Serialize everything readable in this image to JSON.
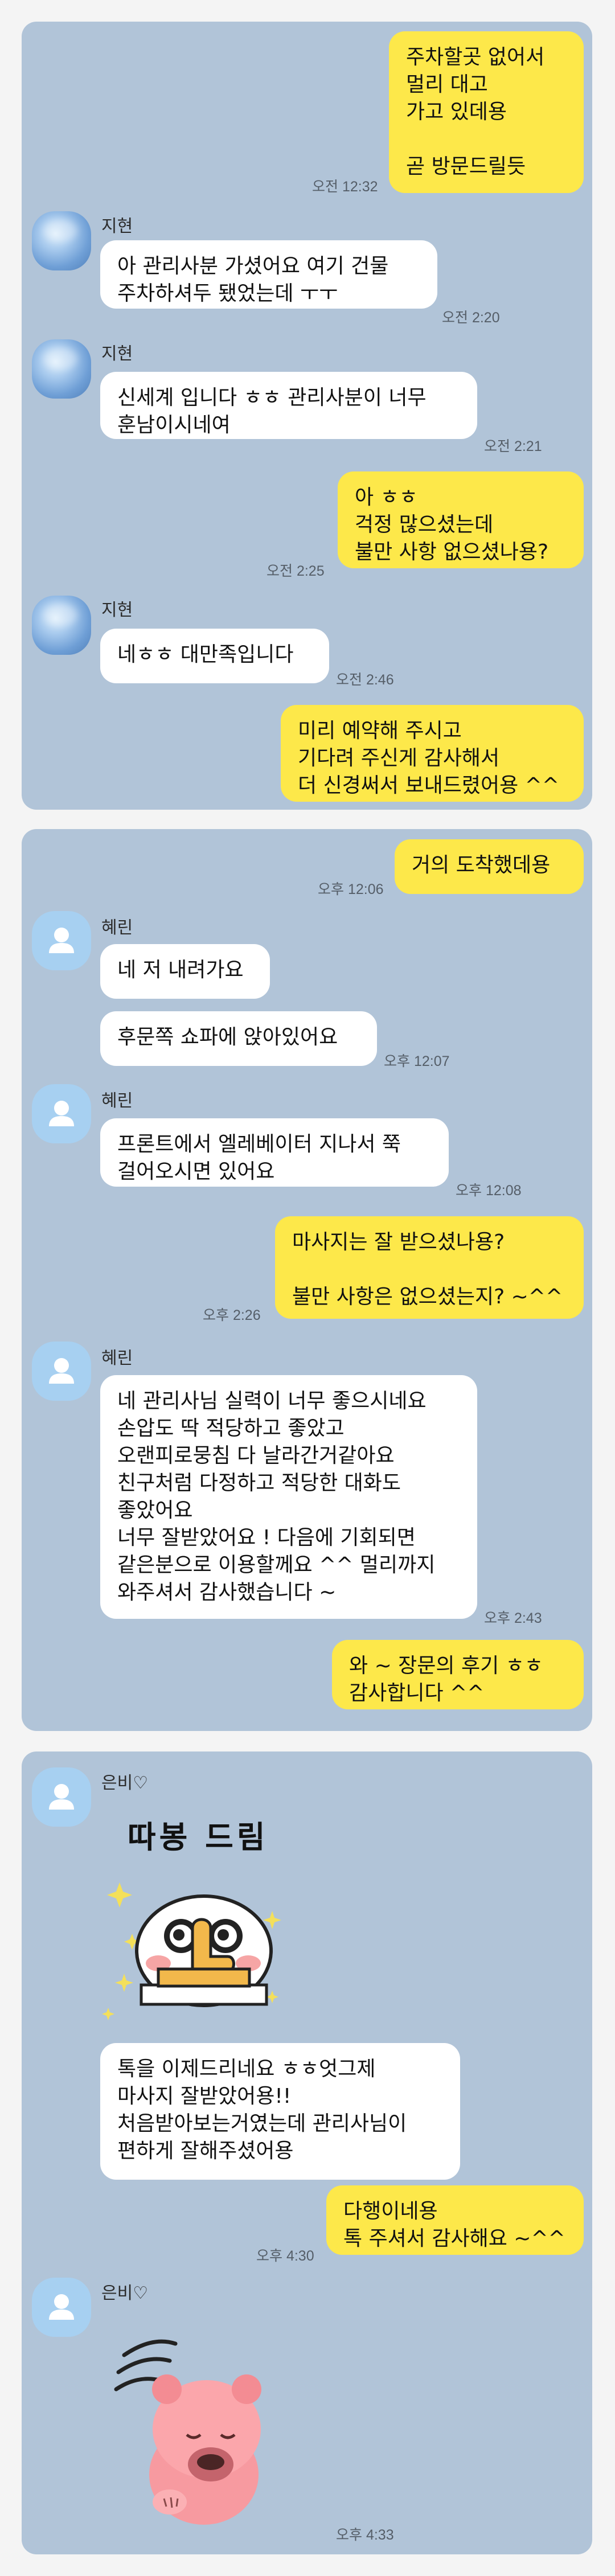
{
  "panel1": {
    "m1": {
      "lines": "주차할곳 없어서\n멀리 대고\n가고 있데용\n\n곧 방문드릴듯",
      "time": "오전 12:32"
    },
    "m2": {
      "sender": "지현",
      "text": "아 관리사분 가셨어요 여기 건물\n주차하셔두 됐었는데 ㅜㅜ",
      "time": "오전 2:20"
    },
    "m3": {
      "sender": "지현",
      "text": "신세계 입니다 ㅎㅎ 관리사분이 너무\n훈남이시네여",
      "time": "오전 2:21"
    },
    "m4": {
      "text": "아 ㅎㅎ\n걱정 많으셨는데\n불만 사항 없으셨나용?",
      "time": "오전 2:25"
    },
    "m5": {
      "sender": "지현",
      "text": "네ㅎㅎ 대만족입니다",
      "time": "오전 2:46"
    },
    "m6": {
      "text": "미리 예약해 주시고\n기다려 주신게 감사해서\n더 신경써서 보내드렸어용 ^^"
    }
  },
  "panel2": {
    "m1": {
      "text": "거의 도착했데용",
      "time": "오후 12:06"
    },
    "m2": {
      "sender": "혜린",
      "text": "네 저 내려가요"
    },
    "m3": {
      "text": "후문쪽 쇼파에 앉아있어요",
      "time": "오후 12:07"
    },
    "m4": {
      "sender": "혜린",
      "text": "프론트에서 엘레베이터 지나서 쭉\n걸어오시면 있어요",
      "time": "오후 12:08"
    },
    "m5": {
      "text": "마사지는 잘 받으셨나용?\n\n불만 사항은 없으셨는지? ~^^",
      "time": "오후 2:26"
    },
    "m6": {
      "sender": "혜린",
      "text": "네 관리사님 실력이 너무 좋으시네요\n손압도 딱 적당하고 좋았고\n오랜피로뭉침 다 날라간거같아요\n친구처럼 다정하고 적당한 대화도\n좋았어요\n너무 잘받았어요 ! 다음에 기회되면\n같은분으로 이용할께요 ^^ 멀리까지\n와주셔서 감사했습니다 ~",
      "time": "오후 2:43"
    },
    "m7": {
      "text": "와 ~ 장문의 후기 ㅎㅎ\n감사합니다 ^^"
    }
  },
  "panel3": {
    "sender": "은비♡",
    "sticker1_text": "따봉 드림",
    "m1": {
      "text": "톡을 이제드리네요 ㅎㅎ엇그제\n마사지 잘받았어용!!\n처음받아보는거였는데 관리사님이\n편하게 잘해주셨어용"
    },
    "m2": {
      "text": "다행이네용\n톡 주셔서 감사해요 ~^^",
      "time": "오후 4:30"
    },
    "sender2": "은비♡",
    "time_last": "오후 4:33"
  },
  "colors": {
    "my_bubble": "#fde84a",
    "other_bubble": "#ffffff",
    "chat_bg": "#b1c4d8",
    "page_bg": "#f4f4f4"
  },
  "icons": {
    "photo_avatar": "avatar-photo",
    "default_avatar": "person-icon"
  }
}
